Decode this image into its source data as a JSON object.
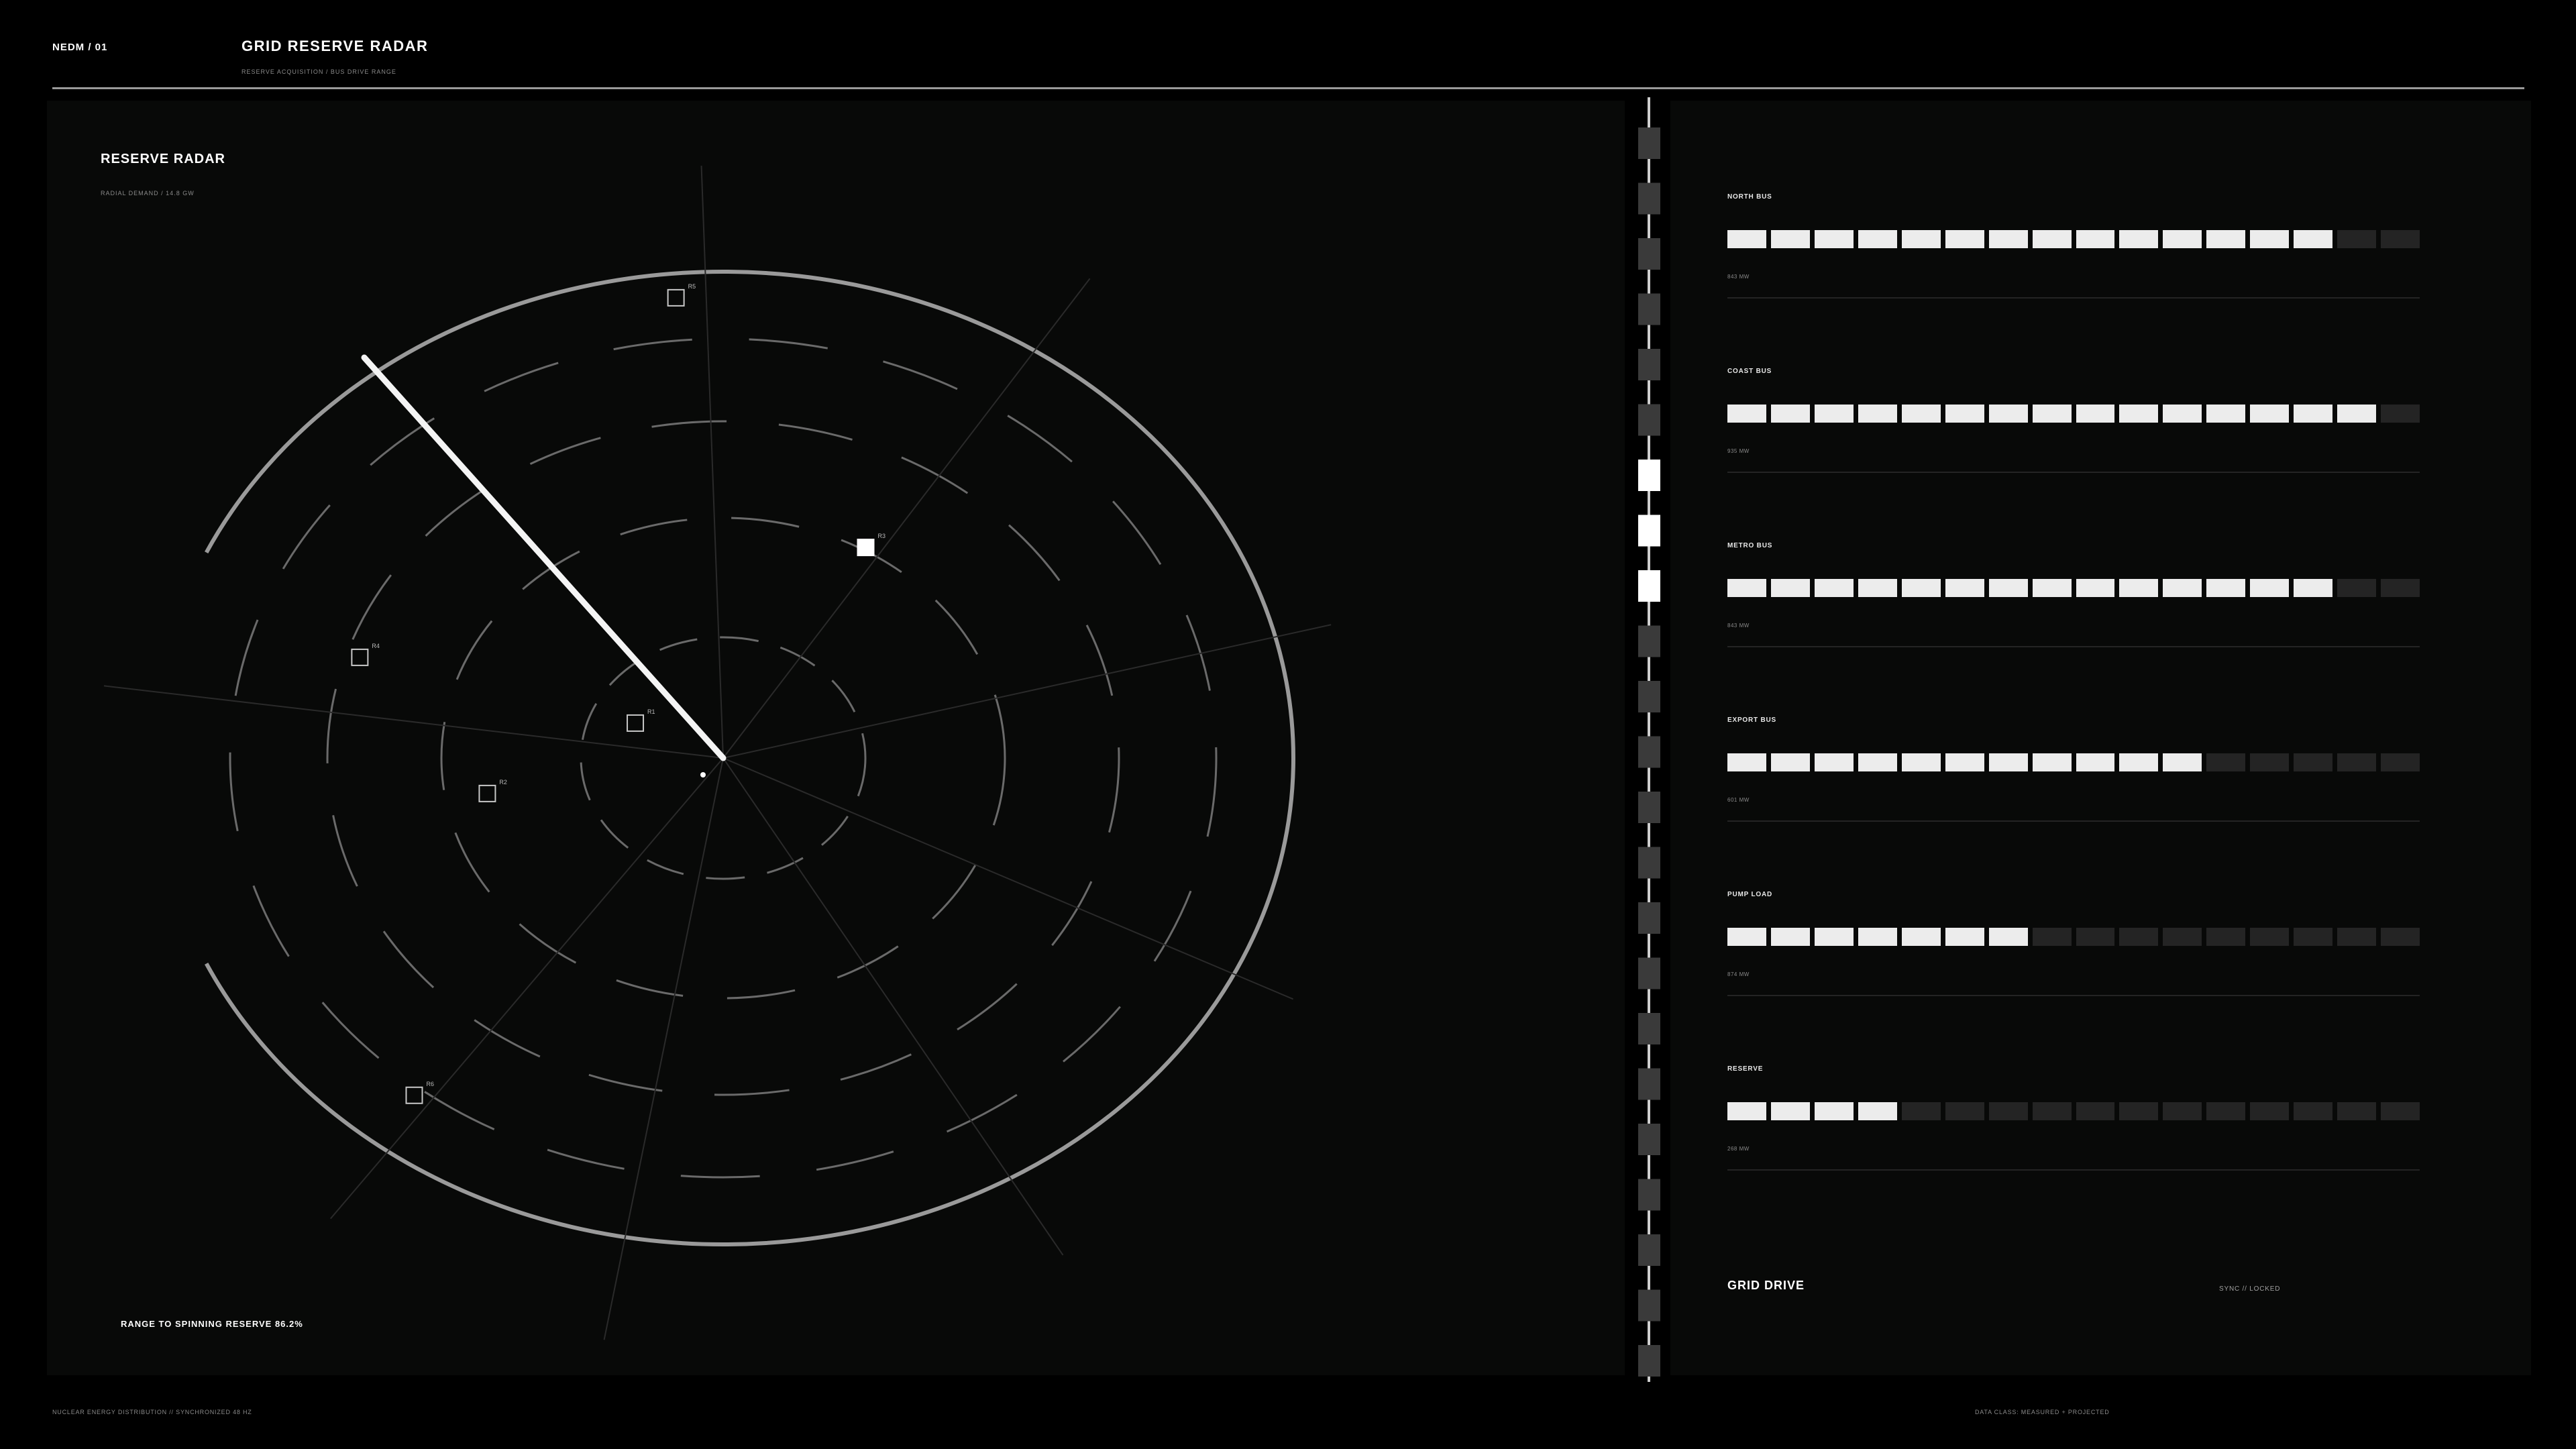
{
  "header": {
    "code": "NEDM / 01",
    "title": "GRID RESERVE RADAR",
    "subtitle": "RESERVE ACQUISITION / BUS DRIVE RANGE"
  },
  "radar": {
    "title": "RESERVE RADAR",
    "subtitle": "RADIAL DEMAND / 14.8 GW",
    "range_label": "RANGE TO SPINNING RESERVE 86.2%",
    "markers": [
      {
        "label": "R1",
        "angle_deg": 205,
        "radius": 0.17,
        "filled": false
      },
      {
        "label": "R2",
        "angle_deg": 170,
        "radius": 0.42,
        "filled": false
      },
      {
        "label": "R3",
        "angle_deg": 300,
        "radius": 0.5,
        "filled": true
      },
      {
        "label": "R4",
        "angle_deg": 198,
        "radius": 0.67,
        "filled": false
      },
      {
        "label": "R5",
        "angle_deg": 265,
        "radius": 0.95,
        "filled": false
      },
      {
        "label": "R6",
        "angle_deg": 128,
        "radius": 0.88,
        "filled": false
      }
    ]
  },
  "buses": [
    {
      "name": "NORTH BUS",
      "value": "843 MW",
      "filled": 14,
      "total": 16
    },
    {
      "name": "COAST BUS",
      "value": "935 MW",
      "filled": 15,
      "total": 16
    },
    {
      "name": "METRO BUS",
      "value": "843 MW",
      "filled": 14,
      "total": 16
    },
    {
      "name": "EXPORT BUS",
      "value": "601 MW",
      "filled": 11,
      "total": 16
    },
    {
      "name": "PUMP LOAD",
      "value": "874 MW",
      "filled": 7,
      "total": 16
    },
    {
      "name": "RESERVE",
      "value": "268 MW",
      "filled": 4,
      "total": 16
    }
  ],
  "drive": {
    "title": "GRID DRIVE",
    "status": "SYNC // LOCKED",
    "active_blocks": [
      6,
      7,
      8
    ]
  },
  "footer": {
    "left": "NUCLEAR ENERGY DISTRIBUTION // SYNCHRONIZED 48 HZ",
    "right": "DATA CLASS: MEASURED + PROJECTED"
  },
  "colors": {
    "background": "#000000",
    "panel": "#080908",
    "ring": "#9a9a9a",
    "segment_on": "#ececec",
    "segment_off": "#242424"
  }
}
